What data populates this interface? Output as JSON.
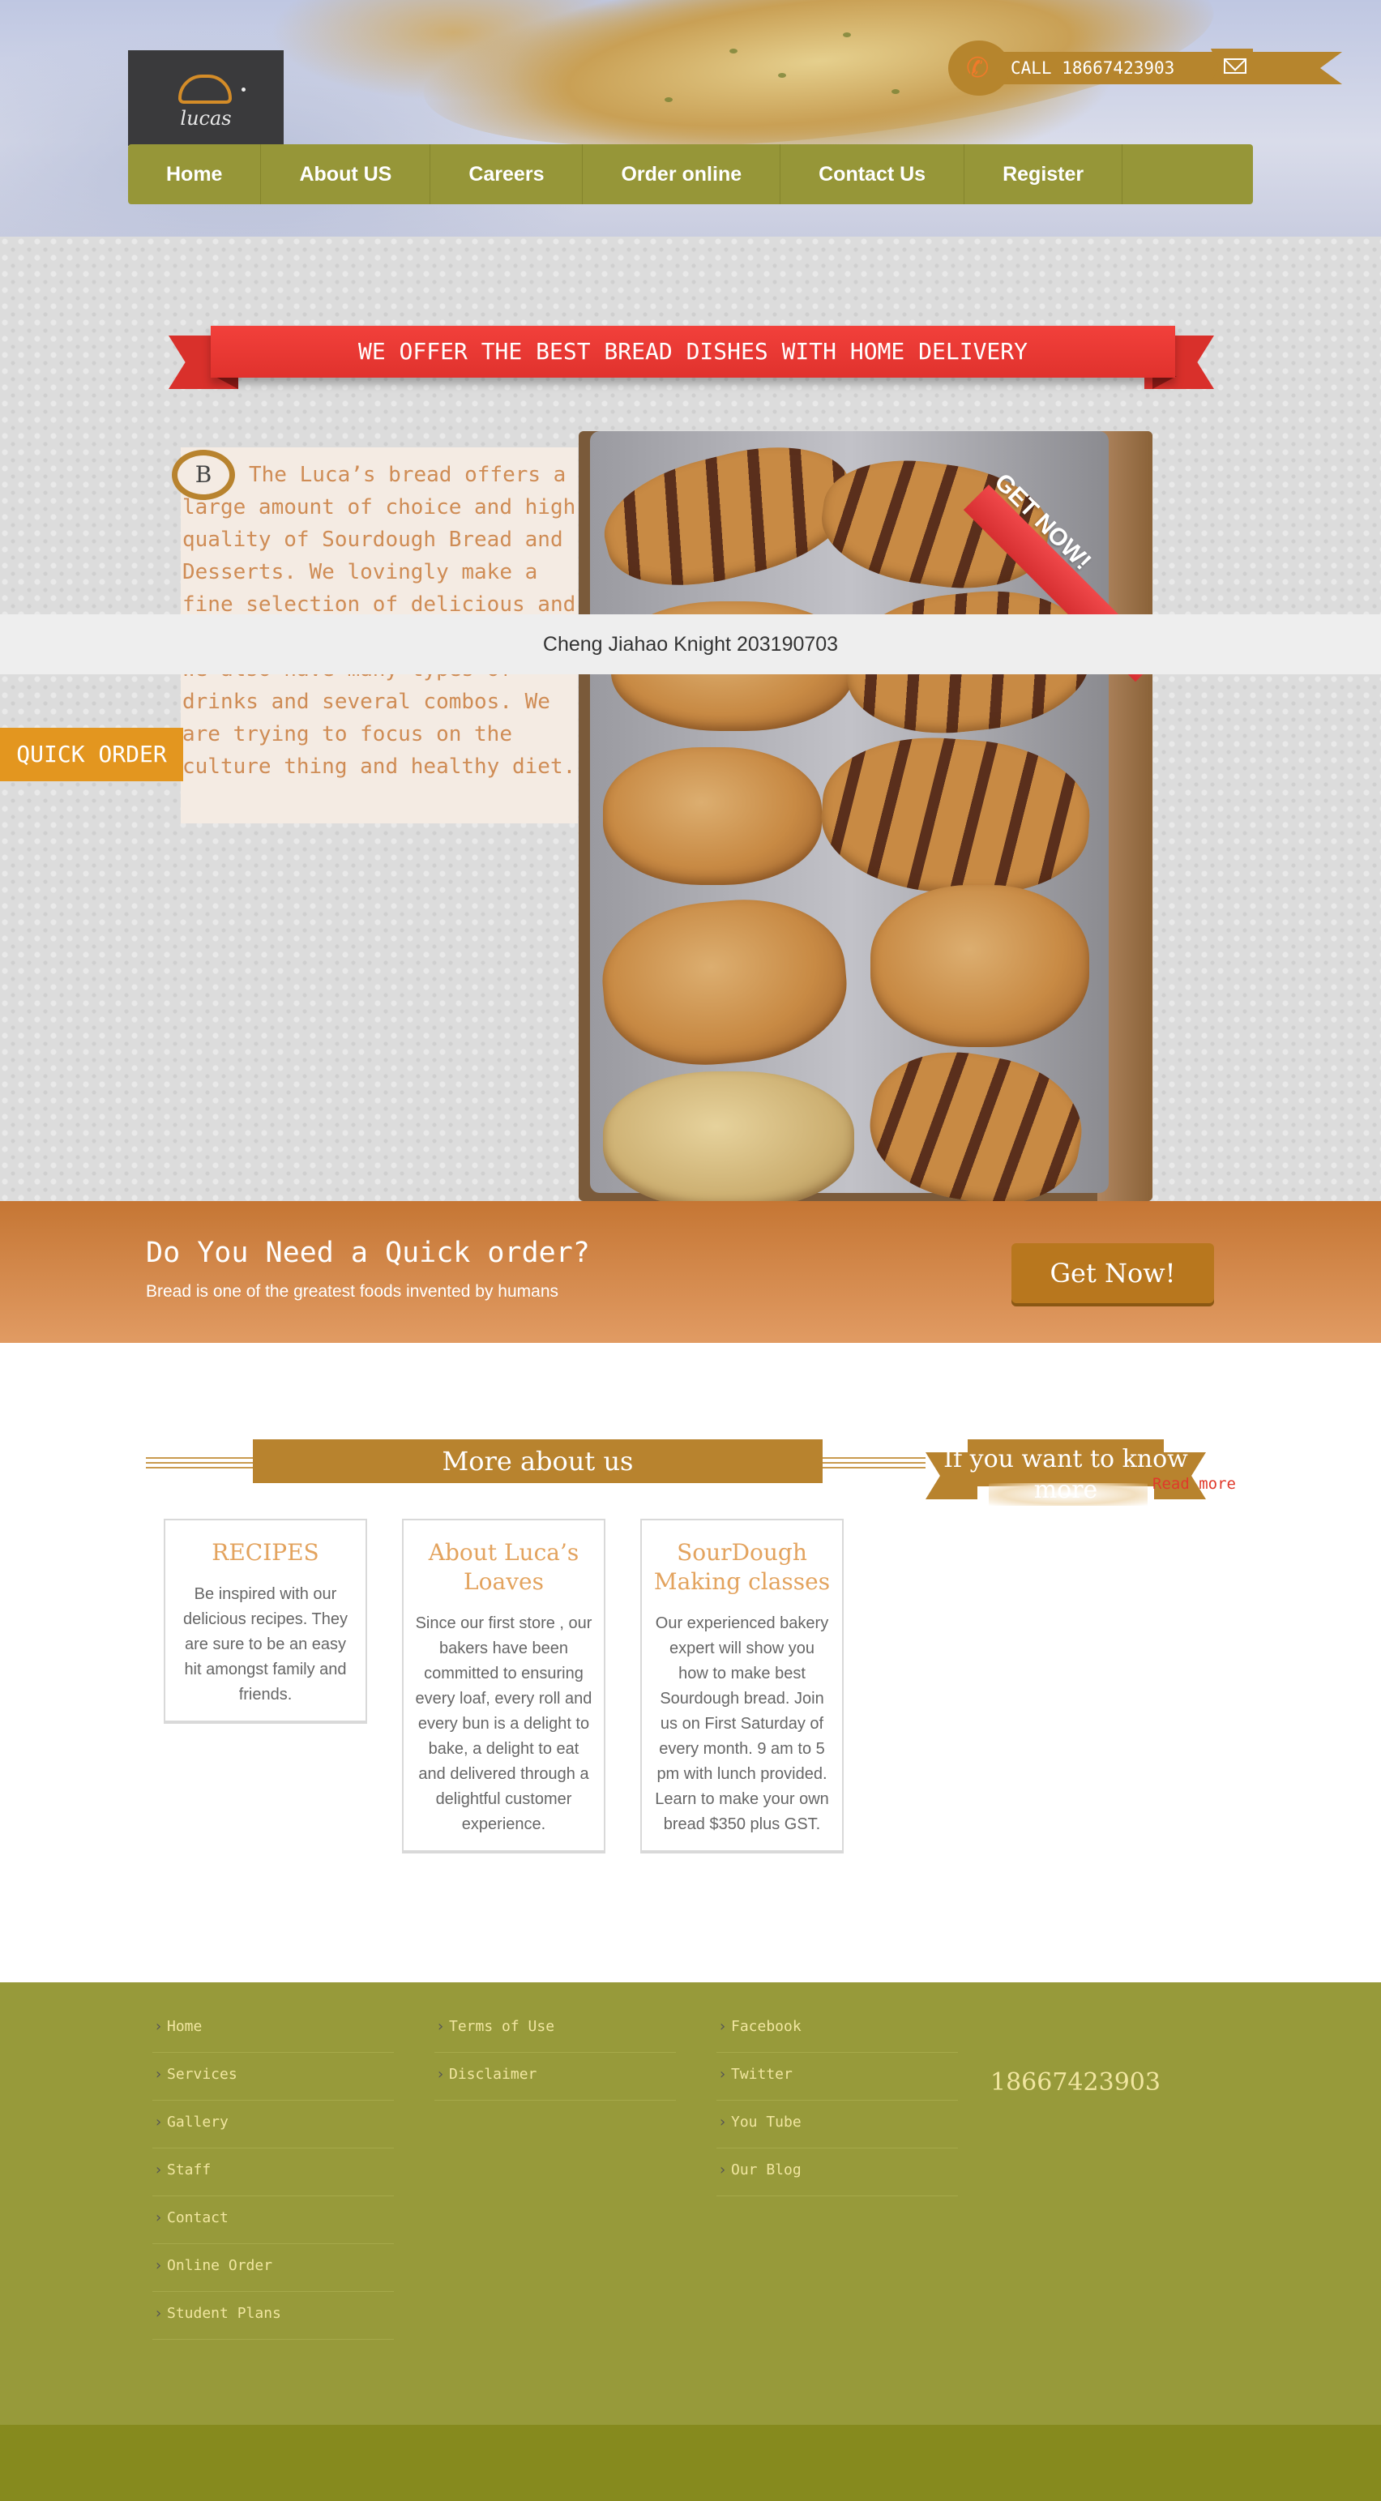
{
  "header": {
    "logo_text": "lucas",
    "phone_label": "CALL 18667423903",
    "nav": [
      {
        "label": "Home"
      },
      {
        "label": "About US"
      },
      {
        "label": "Careers"
      },
      {
        "label": "Order online"
      },
      {
        "label": "Contact Us"
      },
      {
        "label": "Register"
      }
    ]
  },
  "hero": {
    "banner": "WE OFFER THE BEST BREAD DISHES WITH HOME DELIVERY",
    "dropcap": "B",
    "intro": "The Luca’s bread offers a large amount of choice and high quality of Sourdough Bread and Desserts. We lovingly make a fine selection of delicious and special desserts in our Bakery. We also have many types of drinks and several combos. We are trying to focus on the culture thing and healthy diet.",
    "photo_badge": "GET NOW!",
    "caption": "Cheng Jiahao Knight 203190703",
    "quick_order": "QUICK ORDER"
  },
  "cta": {
    "title": "Do You Need a Quick order?",
    "subtitle": "Bread is one of the greatest foods invented by humans",
    "button": "Get Now!"
  },
  "about": {
    "heading": "More about us",
    "know_more": "If you want to know more",
    "read_more": "Read more",
    "cards": [
      {
        "title": "RECIPES",
        "body": "Be inspired with our delicious recipes. They are sure to be an easy hit amongst family and friends."
      },
      {
        "title": "About Luca’s Loaves",
        "body": "Since our first store , our bakers have been committed to ensuring every loaf, every roll and every bun is a delight to bake, a delight to eat and delivered through a delightful customer experience."
      },
      {
        "title": "SourDough Making classes",
        "body": "Our experienced bakery expert will show you how to make best Sourdough bread. Join us on First Saturday of every month. 9 am to 5 pm with lunch provided. Learn to make your own bread $350 plus GST."
      }
    ]
  },
  "footer": {
    "col1": [
      "Home",
      "Services",
      "Gallery",
      "Staff",
      "Contact",
      "Online Order",
      "Student Plans"
    ],
    "col2": [
      "Terms of Use",
      "Disclaimer"
    ],
    "col3": [
      "Facebook",
      "Twitter",
      "You Tube",
      "Our Blog"
    ],
    "phone": "18667423903"
  },
  "colors": {
    "nav_green": "#969638",
    "banner_red": "#e0322d",
    "gold": "#b8832e",
    "cta_orange": "#c57634",
    "quick_order_orange": "#e3961f",
    "footer_green": "#979a3a"
  },
  "icons": [
    "phone-icon",
    "mail-icon",
    "chevron-right-icon"
  ]
}
